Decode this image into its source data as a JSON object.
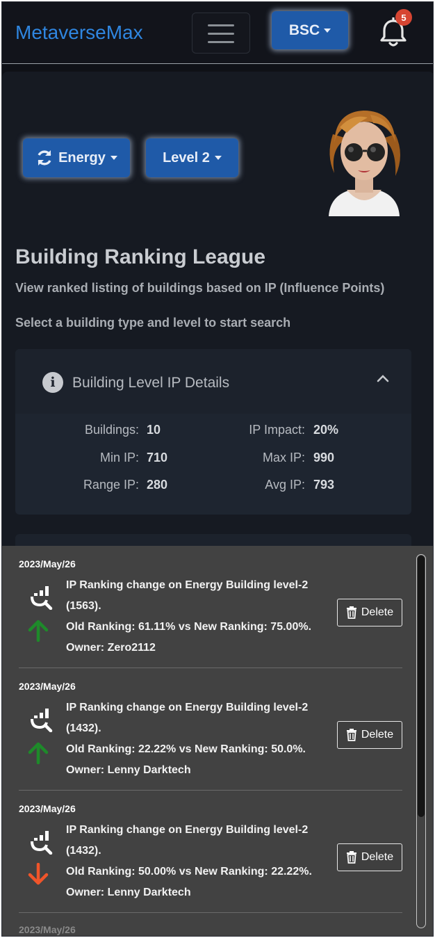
{
  "header": {
    "brand": "MetaverseMax",
    "network_label": "BSC",
    "notification_count": "5"
  },
  "filters": {
    "building_type": "Energy",
    "level": "Level 2"
  },
  "page": {
    "title": "Building Ranking League",
    "subtitle": "View ranked listing of buildings based on IP (Influence Points)",
    "helper": "Select a building type and level to start search"
  },
  "details": {
    "heading": "Building Level IP Details",
    "stats": {
      "buildings_label": "Buildings:",
      "buildings_value": "10",
      "ip_impact_label": "IP Impact:",
      "ip_impact_value": "20%",
      "min_ip_label": "Min IP:",
      "min_ip_value": "710",
      "max_ip_label": "Max IP:",
      "max_ip_value": "990",
      "range_ip_label": "Range IP:",
      "range_ip_value": "280",
      "avg_ip_label": "Avg IP:",
      "avg_ip_value": "793"
    }
  },
  "notifications": {
    "delete_label": "Delete",
    "partial_date": "2023/May/26",
    "items": [
      {
        "date": "2023/May/26",
        "line1": "IP Ranking change on Energy Building level-2",
        "line2": "(1563).",
        "line3": "Old Ranking: 61.11% vs New Ranking: 75.00%.",
        "line4": "Owner: Zero2112",
        "direction": "up"
      },
      {
        "date": "2023/May/26",
        "line1": "IP Ranking change on Energy Building level-2",
        "line2": "(1432).",
        "line3": "Old Ranking: 22.22% vs New Ranking: 50.0%.",
        "line4": "Owner: Lenny Darktech",
        "direction": "up"
      },
      {
        "date": "2023/May/26",
        "line1": "IP Ranking change on Energy Building level-2",
        "line2": "(1432).",
        "line3": "Old Ranking: 50.00% vs New Ranking: 22.22%.",
        "line4": "Owner: Lenny Darktech",
        "direction": "down"
      }
    ]
  },
  "colors": {
    "brand": "#2f86e0",
    "button": "#1f5aa8",
    "up_arrow": "#1e8a2a",
    "down_arrow": "#f0552a",
    "badge": "#d64532"
  }
}
